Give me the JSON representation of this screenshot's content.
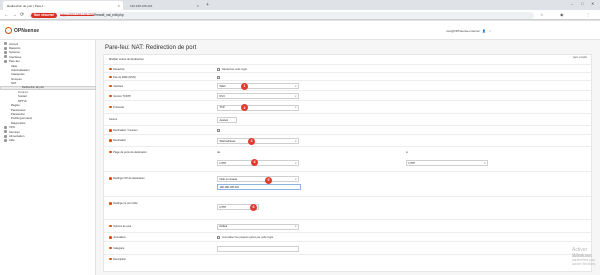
{
  "browser": {
    "tab_active": "Redirection de port | Pare-f...",
    "tab_inactive": "192.168.105.201",
    "not_secure": "Non sécurisé",
    "url_host": "https://192.168.105.254",
    "url_path": "/firewall_nat_edit.php"
  },
  "app": {
    "logo": "OPNsense",
    "user": "root@OPNsense.internal"
  },
  "sidebar": {
    "items": [
      {
        "label": "Accueil",
        "level": 0
      },
      {
        "label": "Rapports",
        "level": 0
      },
      {
        "label": "Système",
        "level": 0
      },
      {
        "label": "Interfaces",
        "level": 0
      },
      {
        "label": "Pare-feu",
        "level": 0
      },
      {
        "label": "Alias",
        "level": 1
      },
      {
        "label": "Automatisation",
        "level": 1
      },
      {
        "label": "Catégories",
        "level": 1
      },
      {
        "label": "Groupes",
        "level": 1
      },
      {
        "label": "NAT",
        "level": 1
      },
      {
        "label": "Redirection de port",
        "level": 2
      },
      {
        "label": "Un à un",
        "level": 2
      },
      {
        "label": "Sortant",
        "level": 2
      },
      {
        "label": "NPTv6",
        "level": 2
      },
      {
        "label": "Règles",
        "level": 1
      },
      {
        "label": "Paramètres",
        "level": 1
      },
      {
        "label": "Paramétrer",
        "level": 1
      },
      {
        "label": "Profils (journaux)",
        "level": 1
      },
      {
        "label": "Diagnostics",
        "level": 1
      },
      {
        "label": "VPN",
        "level": 0
      },
      {
        "label": "Services",
        "level": 0
      },
      {
        "label": "Alimentation",
        "level": 0
      },
      {
        "label": "Aide",
        "level": 0
      }
    ]
  },
  "page": {
    "title": "Pare-feu: NAT: Redirection de port",
    "form_header": "Modifier entrée de Redirection",
    "advanced": "plein compilé"
  },
  "fields": {
    "desactive": {
      "label": "Désactivé",
      "cb": "Désactiver cette règle"
    },
    "no_rdr": {
      "label": "Pas de RDR (NON)"
    },
    "interface": {
      "label": "Interface",
      "value": "WAN"
    },
    "tcpip": {
      "label": "Version TCP/IP",
      "value": "IPv4"
    },
    "protocol": {
      "label": "Protocole",
      "value": "TCP"
    },
    "source": {
      "label": "Source",
      "button": "Avancé"
    },
    "dest_invert": {
      "label": "Destination / Inverser"
    },
    "destination": {
      "label": "Destination",
      "value": "WAN adresse"
    },
    "dest_port": {
      "label": "Plage de ports de destination",
      "de": "de:",
      "a": "à:",
      "from": "HTTP",
      "to": "HTTP"
    },
    "redirect_ip": {
      "label": "Rediriger l'IP de destination",
      "value": "Hôte ou réseau",
      "ip": "192.168.105.201"
    },
    "redirect_port": {
      "label": "Rediriger le port cible",
      "value": "HTTP"
    },
    "pool": {
      "label": "Options de pool",
      "value": "Défaut"
    },
    "log": {
      "label": "Journaliser",
      "cb": "Journaliser les paquets gérés par cette règle"
    },
    "category": {
      "label": "Catégorie"
    },
    "description": {
      "label": "Description"
    }
  },
  "badges": [
    "1",
    "2",
    "3",
    "4",
    "5",
    "6"
  ],
  "watermark": {
    "title": "Activer Windows",
    "sub": "Accédez aux paramètres pour activer Windows."
  }
}
